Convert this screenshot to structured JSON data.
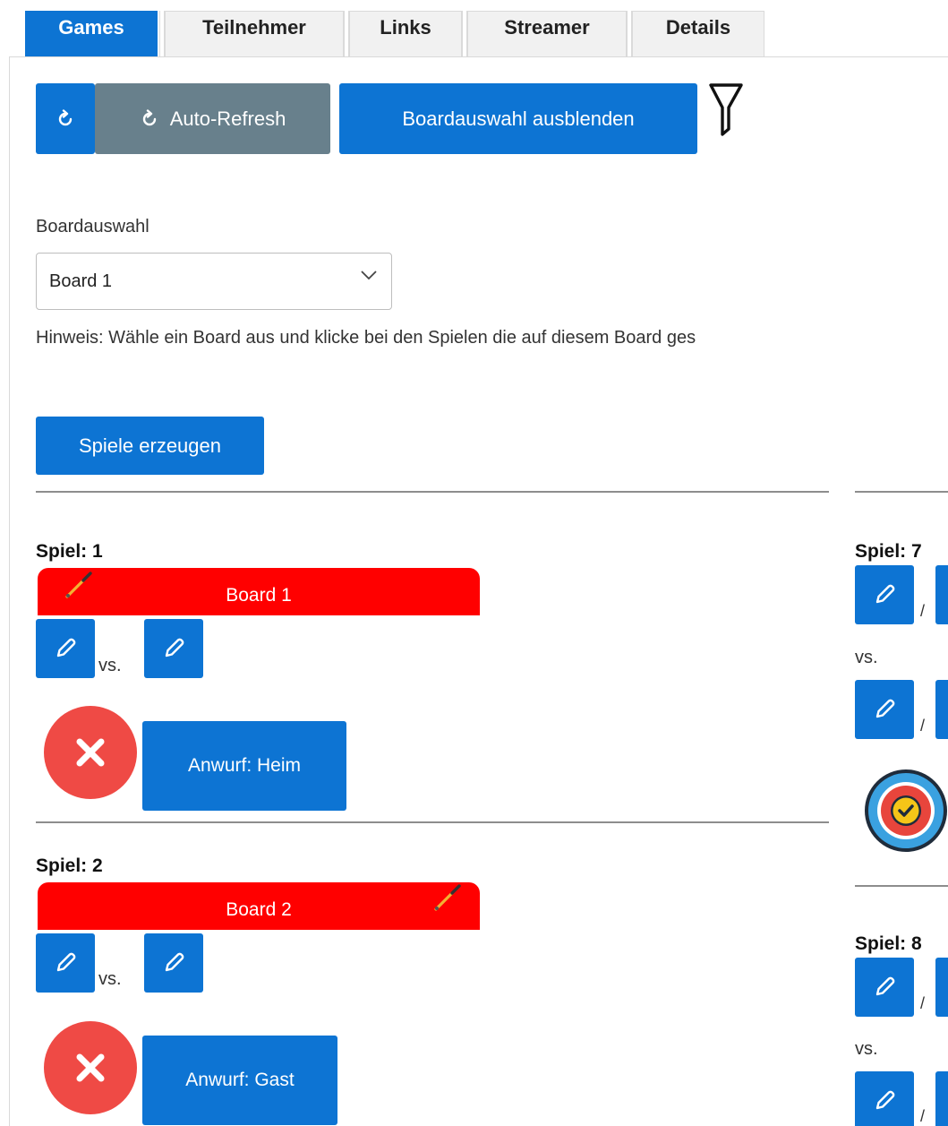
{
  "tabs": [
    {
      "label": "Games",
      "active": true
    },
    {
      "label": "Teilnehmer",
      "active": false
    },
    {
      "label": "Links",
      "active": false
    },
    {
      "label": "Streamer",
      "active": false
    },
    {
      "label": "Details",
      "active": false
    }
  ],
  "toolbar": {
    "refresh_icon": "refresh-icon",
    "auto_refresh_label": "Auto-Refresh",
    "board_toggle_label": "Boardauswahl ausblenden",
    "filter_icon": "filter-icon"
  },
  "board_select": {
    "label": "Boardauswahl",
    "value": "Board 1",
    "hint": "Hinweis: Wähle ein Board aus und klicke bei den Spielen die auf diesem Board ges"
  },
  "generate_button": "Spiele erzeugen",
  "games_left": [
    {
      "title": "Spiel: 1",
      "board": "Board 1",
      "vs": "vs.",
      "anwurf": "Anwurf: Heim"
    },
    {
      "title": "Spiel: 2",
      "board": "Board 2",
      "vs": "vs.",
      "anwurf": "Anwurf: Gast"
    }
  ],
  "games_right": [
    {
      "title": "Spiel: 7",
      "vs": "vs.",
      "slash": "/"
    },
    {
      "title": "Spiel: 8",
      "vs": "vs.",
      "slash": "/"
    }
  ],
  "colors": {
    "primary": "#0d74d3",
    "secondary": "#68808c",
    "board_bar": "#ff0000",
    "cancel": "#ef4a45"
  }
}
